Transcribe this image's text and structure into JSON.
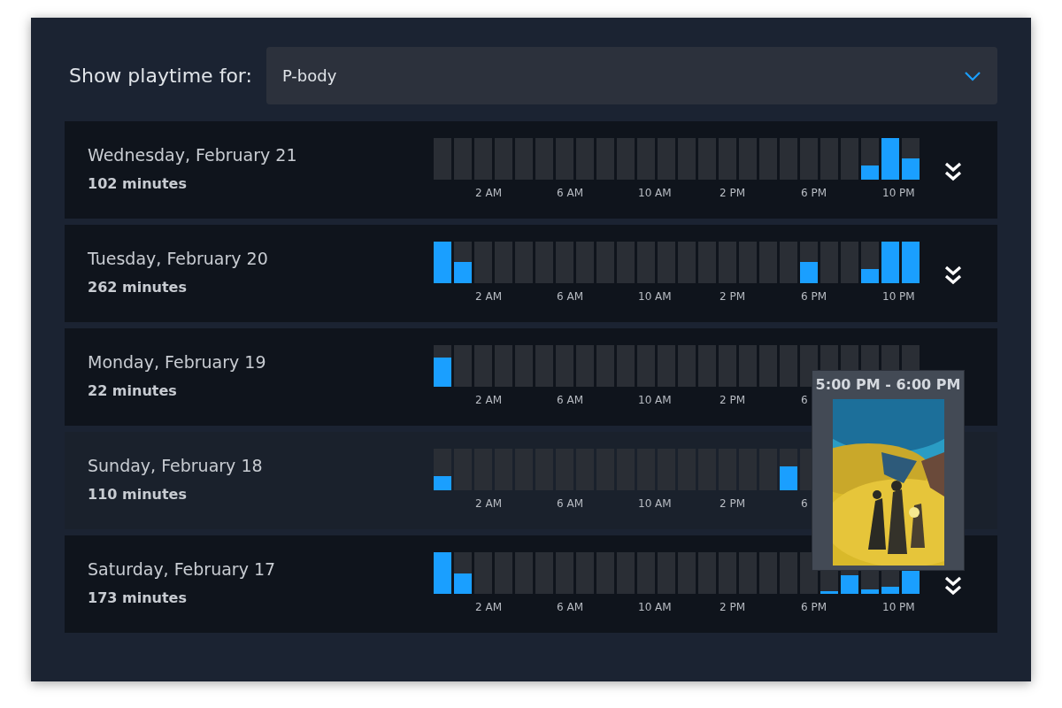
{
  "filter": {
    "label": "Show playtime for:",
    "value": "P-body"
  },
  "days": [
    {
      "date": "Wednesday, February 21",
      "total": "102 minutes",
      "hovered": false,
      "expand_visible": true,
      "labels": [
        "2 AM",
        "6 AM",
        "10 AM",
        "2 PM",
        "6 PM",
        "10 PM"
      ]
    },
    {
      "date": "Tuesday, February 20",
      "total": "262 minutes",
      "hovered": false,
      "expand_visible": true,
      "labels": [
        "2 AM",
        "6 AM",
        "10 AM",
        "2 PM",
        "6 PM",
        "10 PM"
      ]
    },
    {
      "date": "Monday, February 19",
      "total": "22 minutes",
      "hovered": false,
      "expand_visible": false,
      "labels": [
        "2 AM",
        "6 AM",
        "10 AM",
        "2 PM",
        "6"
      ]
    },
    {
      "date": "Sunday, February 18",
      "total": "110 minutes",
      "hovered": true,
      "expand_visible": false,
      "labels": [
        "2 AM",
        "6 AM",
        "10 AM",
        "2 PM",
        "6"
      ]
    },
    {
      "date": "Saturday, February 17",
      "total": "173 minutes",
      "hovered": false,
      "expand_visible": true,
      "labels": [
        "2 AM",
        "6 AM",
        "10 AM",
        "2 PM",
        "6 PM",
        "10 PM"
      ]
    }
  ],
  "tooltip": {
    "title": "5:00 PM - 6:00 PM"
  }
}
